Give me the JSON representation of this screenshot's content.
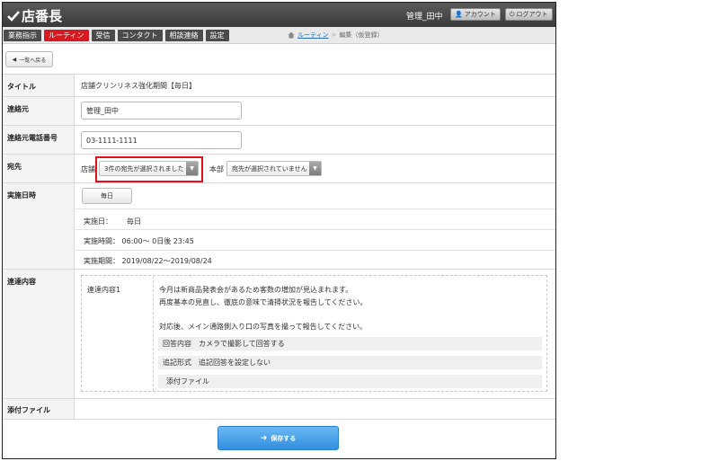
{
  "app": {
    "logo": "店番長"
  },
  "header": {
    "user": "管理_田中",
    "account_label": "アカウント",
    "logout_label": "ログアウト"
  },
  "nav": {
    "tabs": [
      "業務指示",
      "ルーティン",
      "受信",
      "コンタクト",
      "相談連絡",
      "設定"
    ],
    "active_tab": "ルーティン",
    "breadcrumb": {
      "link": "ルーティン",
      "sep": ">",
      "current": "編集（仮登録）"
    }
  },
  "back_label": "一覧へ戻る",
  "form": {
    "title": {
      "label": "タイトル",
      "value": "店舗クリンリネス強化期間【毎日】"
    },
    "contact": {
      "label": "連絡元",
      "value": "管理_田中"
    },
    "phone": {
      "label": "連絡元電話番号",
      "value": "03-1111-1111"
    },
    "dest": {
      "label": "宛先",
      "store_label": "店舗",
      "store_value": "3件の宛先が選択されました",
      "hq_label": "本部",
      "hq_value": "宛先が選択されていません"
    },
    "schedule": {
      "label": "実施日時",
      "button": "毎日",
      "day_label": "実施日：",
      "day_value": "毎日",
      "time": "実施時間： 06:00～ 0日後 23:45",
      "period": "実施期間： 2019/08/22～2019/08/24"
    },
    "contents": {
      "label": "連達内容",
      "item_label": "連達内容1",
      "line1": "今月は新商品発表会があるため客数の増加が見込まれます。",
      "line2": "再度基本の見直し、徹底の意味で清掃状況を報告してください。",
      "line3": "対応後、メイン通路側入り口の写真を撮って報告してください。",
      "answer_key": "回答内容",
      "answer_value": "カメラで撮影して回答する",
      "append_key": "追記形式",
      "append_value": "追記回答を設定しない",
      "attach_label": "添付ファイル"
    },
    "attachment": {
      "label": "添付ファイル"
    }
  },
  "save_label": "保存する",
  "colors": {
    "active_tab": "#d8191f",
    "save_button": "#2f8fe0",
    "highlight": "#e0111b"
  }
}
